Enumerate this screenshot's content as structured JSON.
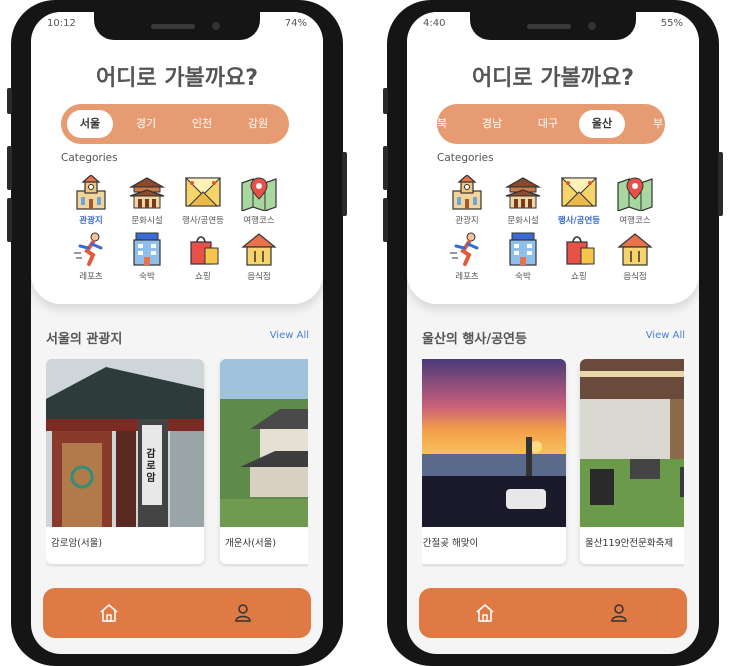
{
  "screens": [
    {
      "status": {
        "time": "10:12",
        "battery": "74%"
      },
      "title": "어디로 가볼까요?",
      "regions": [
        {
          "label": "서울",
          "active": true
        },
        {
          "label": "경기",
          "active": false
        },
        {
          "label": "인천",
          "active": false
        },
        {
          "label": "강원",
          "active": false
        }
      ],
      "categories_label": "Categories",
      "categories": [
        {
          "icon": "tower-icon",
          "label": "관광지",
          "active": true
        },
        {
          "icon": "palace-icon",
          "label": "문화시설",
          "active": false
        },
        {
          "icon": "stage-icon",
          "label": "행사/공연등",
          "active": false
        },
        {
          "icon": "map-pin-icon",
          "label": "여행코스",
          "active": false
        },
        {
          "icon": "runner-icon",
          "label": "레포츠",
          "active": false
        },
        {
          "icon": "hotel-icon",
          "label": "숙박",
          "active": false
        },
        {
          "icon": "shopping-bag-icon",
          "label": "쇼핑",
          "active": false
        },
        {
          "icon": "restaurant-icon",
          "label": "음식점",
          "active": false
        }
      ],
      "section_title": "서울의 관광지",
      "view_all": "View All",
      "cards": [
        {
          "name": "감로암(서울)",
          "sign_text": "감로암"
        },
        {
          "name": "개운사(서울)"
        }
      ],
      "nav": [
        {
          "icon": "home-icon"
        },
        {
          "icon": "profile-icon"
        }
      ]
    },
    {
      "status": {
        "time": "4:40",
        "battery": "55%"
      },
      "title": "어디로 가볼까요?",
      "regions": [
        {
          "label": "북",
          "active": false
        },
        {
          "label": "경남",
          "active": false
        },
        {
          "label": "대구",
          "active": false
        },
        {
          "label": "울산",
          "active": true
        },
        {
          "label": "부",
          "active": false
        }
      ],
      "categories_label": "Categories",
      "categories": [
        {
          "icon": "tower-icon",
          "label": "관광지",
          "active": false
        },
        {
          "icon": "palace-icon",
          "label": "문화시설",
          "active": false
        },
        {
          "icon": "stage-icon",
          "label": "행사/공연등",
          "active": true
        },
        {
          "icon": "map-pin-icon",
          "label": "여행코스",
          "active": false
        },
        {
          "icon": "runner-icon",
          "label": "레포츠",
          "active": false
        },
        {
          "icon": "hotel-icon",
          "label": "숙박",
          "active": false
        },
        {
          "icon": "shopping-bag-icon",
          "label": "쇼핑",
          "active": false
        },
        {
          "icon": "restaurant-icon",
          "label": "음식점",
          "active": false
        }
      ],
      "section_title": "울산의 행사/공연등",
      "view_all": "View All",
      "cards": [
        {
          "name": "산 간절곶 해맞이"
        },
        {
          "name": "울산119안전문화축제"
        }
      ],
      "nav": [
        {
          "icon": "home-icon"
        },
        {
          "icon": "profile-icon"
        }
      ]
    }
  ],
  "colors": {
    "accent": "#e07a45",
    "region_bar": "#e79b72",
    "active_category": "#3a6bd4",
    "view_all": "#4a7fd4",
    "title_text": "#555555"
  }
}
